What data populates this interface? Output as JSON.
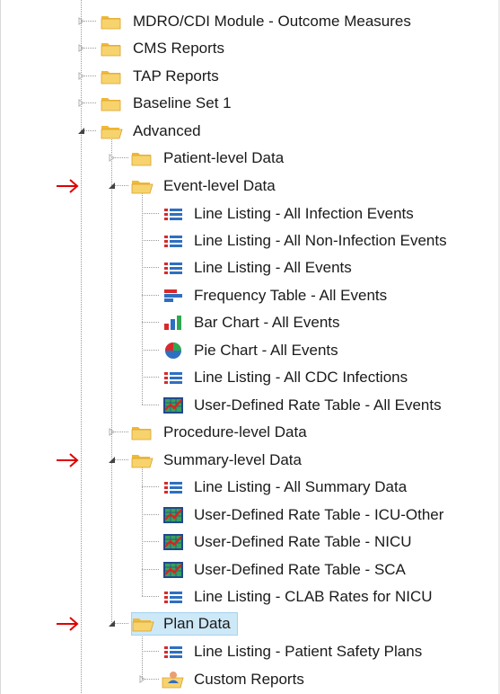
{
  "tree": {
    "root_nodes": [
      {
        "label": "MDRO/CDI Module - Outcome Measures",
        "icon": "folder-icon"
      },
      {
        "label": "CMS Reports",
        "icon": "folder-icon"
      },
      {
        "label": "TAP Reports",
        "icon": "folder-icon"
      },
      {
        "label": "Baseline Set 1",
        "icon": "folder-icon"
      },
      {
        "label": "Advanced",
        "icon": "folder-open-icon",
        "expanded": true
      }
    ],
    "advanced_children": [
      {
        "label": "Patient-level Data",
        "icon": "folder-icon"
      },
      {
        "label": "Event-level Data",
        "icon": "folder-open-icon",
        "expanded": true
      },
      {
        "label": "Procedure-level Data",
        "icon": "folder-icon"
      },
      {
        "label": "Summary-level Data",
        "icon": "folder-open-icon",
        "expanded": true
      },
      {
        "label": "Plan Data",
        "icon": "folder-open-icon",
        "expanded": true,
        "selected": true
      }
    ],
    "event_level_items": [
      {
        "label": "Line Listing - All Infection Events",
        "icon": "line-listing-icon"
      },
      {
        "label": "Line Listing - All Non-Infection Events",
        "icon": "line-listing-icon"
      },
      {
        "label": "Line Listing - All Events",
        "icon": "line-listing-icon"
      },
      {
        "label": "Frequency Table - All Events",
        "icon": "frequency-table-icon"
      },
      {
        "label": "Bar Chart - All Events",
        "icon": "bar-chart-icon"
      },
      {
        "label": "Pie Chart - All Events",
        "icon": "pie-chart-icon"
      },
      {
        "label": "Line Listing - All CDC Infections",
        "icon": "line-listing-icon"
      },
      {
        "label": "User-Defined Rate Table - All Events",
        "icon": "rate-table-icon"
      }
    ],
    "summary_level_items": [
      {
        "label": "Line Listing - All Summary Data",
        "icon": "line-listing-icon"
      },
      {
        "label": "User-Defined Rate Table - ICU-Other",
        "icon": "rate-table-icon"
      },
      {
        "label": "User-Defined Rate Table - NICU",
        "icon": "rate-table-icon"
      },
      {
        "label": "User-Defined Rate Table - SCA",
        "icon": "rate-table-icon"
      },
      {
        "label": "Line Listing - CLAB Rates for NICU",
        "icon": "line-listing-icon"
      }
    ],
    "plan_items": [
      {
        "label": "Line Listing - Patient Safety Plans",
        "icon": "line-listing-icon"
      },
      {
        "label": "Custom Reports",
        "icon": "custom-reports-icon"
      }
    ]
  },
  "colors": {
    "annotation_arrow": "#e00000",
    "folder": "#f2c14e",
    "selected_background": "#cde8f6"
  }
}
